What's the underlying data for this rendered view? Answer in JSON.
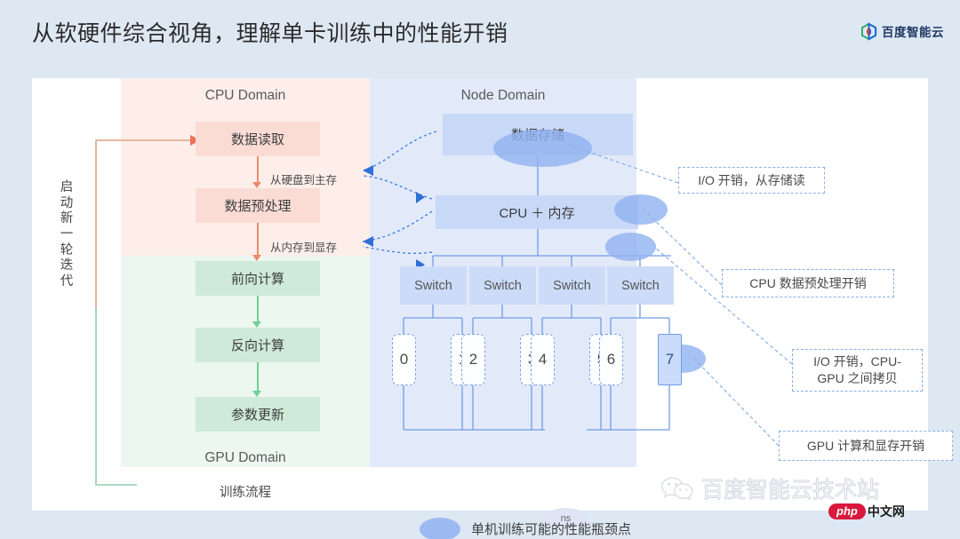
{
  "header": {
    "title": "从软硬件综合视角，理解单卡训练中的性能开销",
    "brand": "百度智能云",
    "brand_icon": "baidu-cloud-logo"
  },
  "diagram": {
    "cpu_domain_label": "CPU Domain",
    "gpu_domain_label": "GPU Domain",
    "node_domain_label": "Node Domain",
    "flow_caption": "训练流程",
    "loop_label": "启动新一轮迭代",
    "flow_steps": [
      {
        "label": "数据读取",
        "zone": "cpu"
      },
      {
        "label": "数据预处理",
        "zone": "cpu"
      },
      {
        "label": "前向计算",
        "zone": "gpu"
      },
      {
        "label": "反向计算",
        "zone": "gpu"
      },
      {
        "label": "参数更新",
        "zone": "gpu"
      }
    ],
    "transfer_hints": [
      "从硬盘到主存",
      "从内存到显存"
    ],
    "node_blocks": {
      "storage": "数据存储",
      "cpu_memory": "CPU ＋ 内存"
    },
    "switches": [
      "Switch",
      "Switch",
      "Switch",
      "Switch"
    ],
    "gpus": [
      "0",
      "1",
      "2",
      "3",
      "4",
      "5",
      "6",
      "7"
    ],
    "highlighted_gpu": "7",
    "bus_label": "ns",
    "callouts": [
      "I/O 开销，从存储读",
      "CPU 数据预处理开销",
      "I/O 开销，CPU-GPU 之间拷贝",
      "GPU 计算和显存开销"
    ]
  },
  "legend": {
    "marker": "bottleneck-ellipse",
    "text": "单机训练可能的性能瓶颈点"
  },
  "watermark": {
    "icon": "wechat-icon",
    "text": "百度智能云技术站",
    "badge_primary": "php",
    "badge_secondary": "中文网"
  },
  "colors": {
    "page_background": "#dde8f3",
    "canvas": "#ffffff",
    "cpu_zone": "#fdeeea",
    "gpu_zone": "#ebf7ef",
    "node_zone": "#e2eaf9",
    "cpu_box": "#fadcd5",
    "gpu_box": "#cfead9",
    "node_box": "#c8d8f7",
    "bottleneck": "#93b3f0",
    "pink_arrow": "#f08a6c",
    "green_arrow": "#6fcf97",
    "blue_line": "#7ba4e8"
  }
}
